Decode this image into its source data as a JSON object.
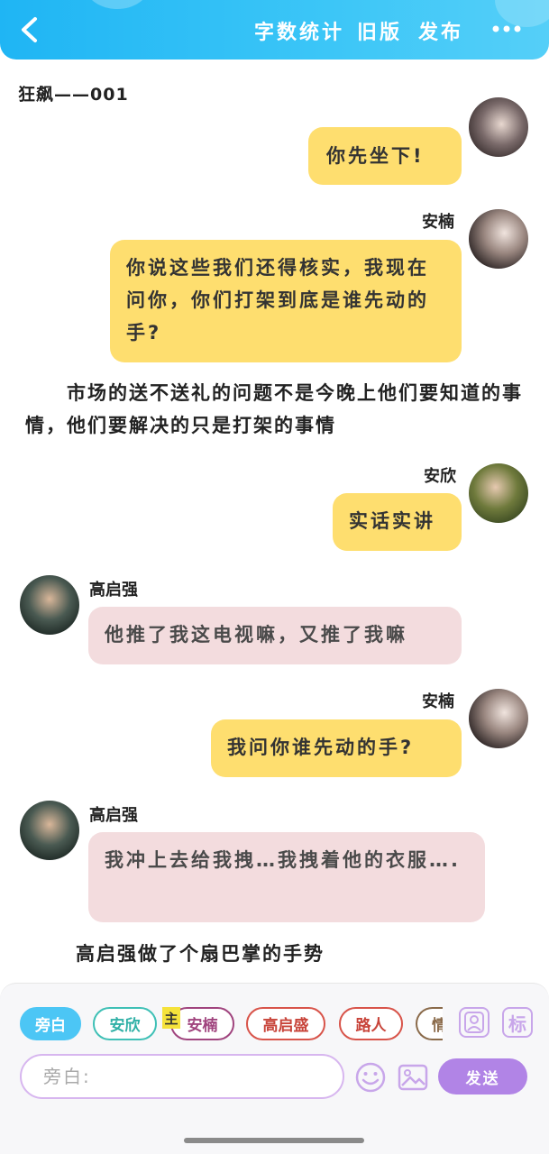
{
  "header": {
    "word_count_label": "字数统计",
    "old_version_label": "旧版",
    "publish_label": "发布"
  },
  "doc_title": "狂飙——001",
  "messages": [
    {
      "type": "bubble",
      "side": "right",
      "speaker": "",
      "text": "你先坐下!"
    },
    {
      "type": "bubble",
      "side": "right",
      "speaker": "安楠",
      "text": "你说这些我们还得核实，我现在问你，你们打架到底是谁先动的手?"
    },
    {
      "type": "narration",
      "text": "　　市场的送不送礼的问题不是今晚上他们要知道的事情，他们要解决的只是打架的事情"
    },
    {
      "type": "bubble",
      "side": "right",
      "speaker": "安欣",
      "text": "实话实讲"
    },
    {
      "type": "bubble",
      "side": "left",
      "speaker": "高启强",
      "text": "他推了我这电视嘛，又推了我嘛"
    },
    {
      "type": "bubble",
      "side": "right",
      "speaker": "安楠",
      "text": "我问你谁先动的手?"
    },
    {
      "type": "bubble",
      "side": "left",
      "speaker": "高启强",
      "text": "我冲上去给我拽…我拽着他的衣服…."
    },
    {
      "type": "narration",
      "text": "高启强做了个扇巴掌的手势"
    }
  ],
  "composer": {
    "chips": [
      "旁白",
      "安欣",
      "安楠",
      "高启盛",
      "路人",
      "情"
    ],
    "main_badge": "主",
    "label_icon_text": "标",
    "input_placeholder": "旁白:",
    "send_label": "发送"
  },
  "colors": {
    "header": "#2bbdf5",
    "bubble_yellow": "#fede6f",
    "bubble_pink": "#f3dcde",
    "accent_purple": "#b184e6",
    "chip_active": "#4cc6f5"
  }
}
